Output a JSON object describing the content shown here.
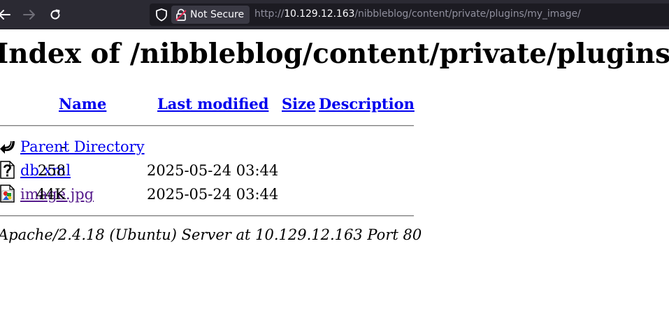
{
  "browser": {
    "security_label": "Not Secure",
    "url_prefix": "http://",
    "url_host": "10.129.12.163",
    "url_path": "/nibbleblog/content/private/plugins/my_image/"
  },
  "page": {
    "title": "Index of /nibbleblog/content/private/plugins/my_image",
    "columns": {
      "name": "Name",
      "last_modified": "Last modified",
      "size": "Size",
      "description": "Description"
    },
    "rows": [
      {
        "name": "Parent Directory",
        "modified": "",
        "size": "-",
        "icon": "back-icon"
      },
      {
        "name": "db.xml",
        "modified": "2025-05-24 03:44",
        "size": "258",
        "icon": "unknown-file-icon"
      },
      {
        "name": "image.jpg",
        "modified": "2025-05-24 03:44",
        "size": "44K",
        "icon": "image-file-icon"
      }
    ],
    "server_signature": "Apache/2.4.18 (Ubuntu) Server at 10.129.12.163 Port 80"
  }
}
